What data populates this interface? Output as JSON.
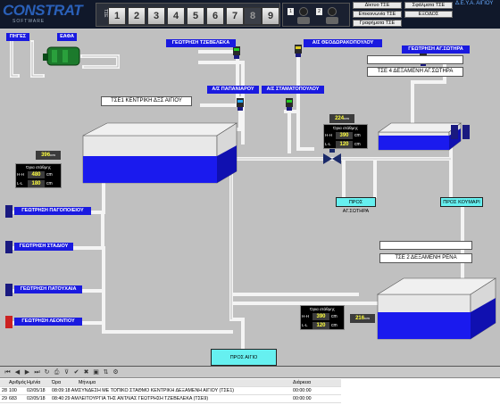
{
  "header": {
    "logo": "CONSTRAT",
    "logo_sub": "SOFTWARE",
    "tse_label": "ΤΣΕ",
    "tse_buttons": [
      "1",
      "2",
      "3",
      "4",
      "5",
      "6",
      "7",
      "8",
      "9"
    ],
    "joy_tags": [
      "1",
      "2"
    ],
    "deya": "Δ.Ε.Υ.Α. ΑΙΓΙΟΥ",
    "menu": {
      "diktyo": "Δίκτυο ΤΣΕ",
      "epikoinonia": "Επικοινωνία ΤΣΕ",
      "grafimata": "Γραφήματα ΤΣΕ",
      "sfalmata": "Σφάλματα ΤΣΕ",
      "exodos": "ΕΞΟΔΟΣ"
    }
  },
  "labels": {
    "pigei": "ΠΗΓΕΣ",
    "eafa": "ΕΑΦΑ",
    "tzeveleka": "ΓΕΩΤΡΗΣΗ ΤΖΕΒΕΛΕΚΑ",
    "theodorakopoulou": "Α/Σ ΘΕΟΔΩΡΑΚΟΠΟΥΛΟΥ",
    "ag_sotira": "ΓΕΩΤΡΗΣΗ ΑΓ.ΣΩΤΗΡΑ",
    "papaniarou": "Α/Σ ΠΑΠΑΝΙΑΡΟΥ",
    "stamatopoulou": "Α/Σ ΣΤΑΜΑΤΟΠΟΥΛΟΥ",
    "pagopoieiou": "ΓΕΩΤΡΗΣΗ ΠΑΓΟΠΟΙΕΙΟΥ",
    "stadiou": "ΓΕΩΤΡΗΣΗ ΣΤΑΔΙΟΥ",
    "patouxaia": "ΓΕΩΤΡΗΣΗ ΠΑΤΟΥΧΑΙΑ",
    "leontiou": "ΓΕΩΤΡΗΣΗ ΛΕΟΝΤΙΟΥ"
  },
  "titles": {
    "tse1": "ΤΣΕ1 ΚΕΝΤΡΙΚΗ ΔΞΣ ΑΙΓΙΟΥ",
    "tse4": "ΤΣΕ 4 ΔΕΞΑΜΕΝΗ ΑΓ.ΣΩΤΗΡΑ",
    "tse2": "ΤΣΕ 2 ΔΕΞΑΜΕΝΗ ΡΕΝΑ"
  },
  "buttons": {
    "pros_sotira": "ΠΡΟΣ ΑΓ.ΣΩΤΗΡΑ",
    "pros_koumari": "ΠΡΟΣ ΚΟΥΜΑΡΙ",
    "pros_aigio": "ΠΡΟΣ ΑΙΓΙΟ"
  },
  "levels": {
    "tse1": "396",
    "tse4": "224",
    "tse2": "216",
    "unit": "cm"
  },
  "setpoints": {
    "title": "Όρια στάθμης",
    "hh_key": "H-H",
    "ll_key": "L-L",
    "unit": "cm",
    "tse1": {
      "hh": "480",
      "ll": "180"
    },
    "tse4": {
      "hh": "390",
      "ll": "120"
    },
    "tse2": {
      "hh": "390",
      "ll": "120"
    }
  },
  "table": {
    "headers": [
      "",
      "Αριθμός",
      "Ημ/νία",
      "Ώρα",
      "Μήνυμα",
      "Διάρκεια"
    ],
    "rows": [
      [
        "28",
        "100",
        "02/05/18",
        "08:09:18 AM",
        "ΣΥΝΔΕΣΗ ΜΕ ΤΟΠΙΚΟ ΣΤΑΘΜΟ ΚΕΝΤΡΙΚΗ ΔΕΞΑΜΕΝΗ ΑΙΓΙΟΥ (ΤΣΕ1)",
        "00:00:00"
      ],
      [
        "29",
        "683",
        "02/05/18",
        "08:40:29 AM",
        "ΛΕΙΤΟΥΡΓΙΑ ΤΗΣ ΑΝΤΛΙΑΣ ΓΕΩΤΡΗΣΗ ΤΖΕΒΕΛΕΚΑ (ΤΣΕ9)",
        "00:00:00"
      ]
    ]
  }
}
